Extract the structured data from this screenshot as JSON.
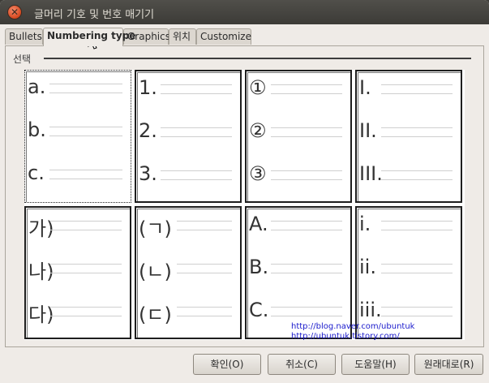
{
  "window": {
    "title": "글머리 기호 및 번호 매기기"
  },
  "tabs": [
    {
      "label": "Bullets"
    },
    {
      "label": "Numbering type"
    },
    {
      "label": "Graphics"
    },
    {
      "label": "위치"
    },
    {
      "label": "Customize"
    }
  ],
  "section": {
    "label": "선택"
  },
  "cells": [
    {
      "items": [
        "a.",
        "b.",
        "c."
      ]
    },
    {
      "items": [
        "1.",
        "2.",
        "3."
      ]
    },
    {
      "items": [
        "①",
        "②",
        "③"
      ]
    },
    {
      "items": [
        "I.",
        "II.",
        "III."
      ]
    },
    {
      "items": [
        "가)",
        "나)",
        "다)"
      ]
    },
    {
      "items": [
        "(ㄱ)",
        "(ㄴ)",
        "(ㄷ)"
      ]
    },
    {
      "items": [
        "A.",
        "B.",
        "C."
      ]
    },
    {
      "items": [
        "i.",
        "ii.",
        "iii."
      ]
    }
  ],
  "watermark": {
    "line1": "http://blog.naver.com/ubuntuk",
    "line2": "http://ubuntuk.tistory.com/"
  },
  "buttons": {
    "ok": "확인(O)",
    "cancel": "취소(C)",
    "help": "도움말(H)",
    "reset": "원래대로(R)"
  },
  "icons": {
    "close": "close-icon",
    "cursor": "mouse-pointer-icon"
  },
  "colors": {
    "titlebar": "#3c3b37",
    "close": "#e05a2f",
    "dialog": "#efebe7"
  }
}
